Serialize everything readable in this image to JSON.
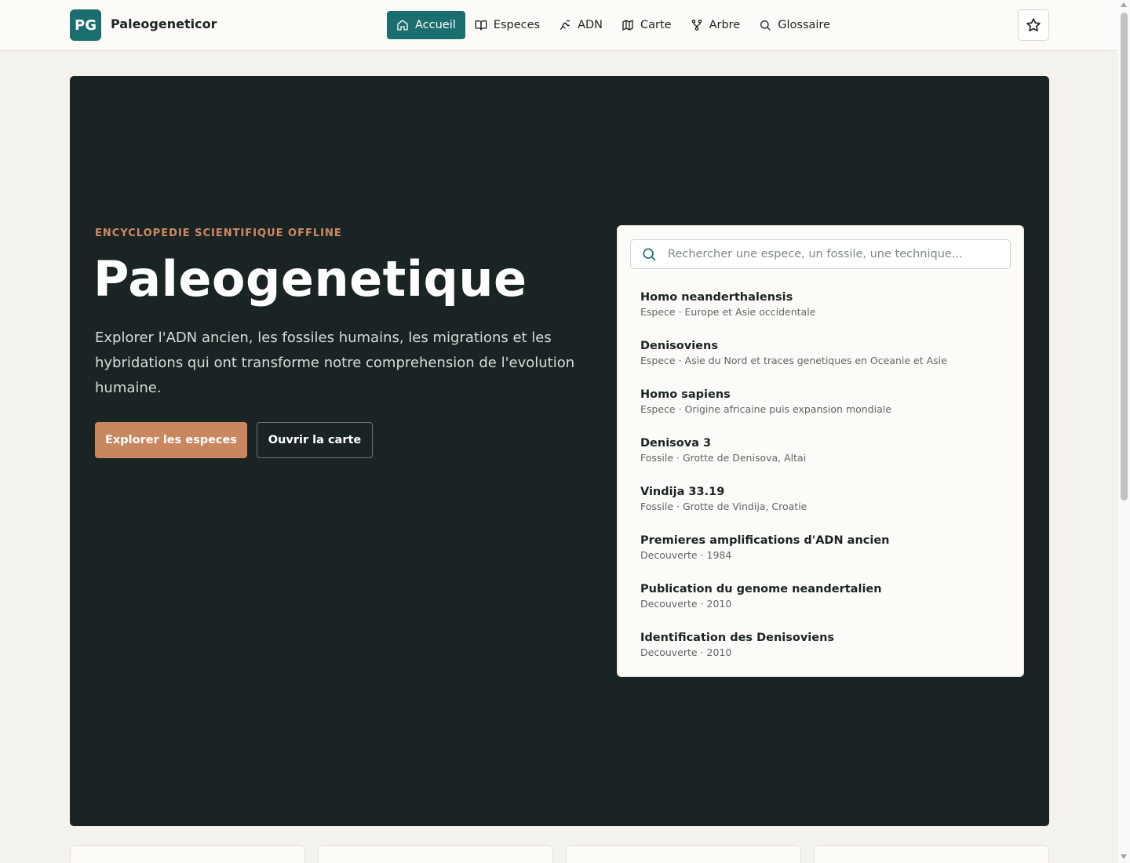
{
  "header": {
    "logo_text": "PG",
    "brand_name": "Paleogeneticor",
    "nav": [
      {
        "label": "Accueil",
        "icon": "home-icon",
        "active": true
      },
      {
        "label": "Especes",
        "icon": "book-icon",
        "active": false
      },
      {
        "label": "ADN",
        "icon": "dna-icon",
        "active": false
      },
      {
        "label": "Carte",
        "icon": "map-icon",
        "active": false
      },
      {
        "label": "Arbre",
        "icon": "tree-icon",
        "active": false
      },
      {
        "label": "Glossaire",
        "icon": "search-icon",
        "active": false
      }
    ],
    "favorites_icon": "star-icon"
  },
  "hero": {
    "eyebrow": "ENCYCLOPEDIE SCIENTIFIQUE OFFLINE",
    "title": "Paleogenetique",
    "description": "Explorer l'ADN ancien, les fossiles humains, les migrations et les hybridations qui ont transforme notre comprehension de l'evolution humaine.",
    "primary_button": "Explorer les especes",
    "secondary_button": "Ouvrir la carte"
  },
  "search": {
    "placeholder": "Rechercher une espece, un fossile, une technique...",
    "results": [
      {
        "title": "Homo neanderthalensis",
        "meta": "Espece · Europe et Asie occidentale"
      },
      {
        "title": "Denisoviens",
        "meta": "Espece · Asie du Nord et traces genetiques en Oceanie et Asie"
      },
      {
        "title": "Homo sapiens",
        "meta": "Espece · Origine africaine puis expansion mondiale"
      },
      {
        "title": "Denisova 3",
        "meta": "Fossile · Grotte de Denisova, Altai"
      },
      {
        "title": "Vindija 33.19",
        "meta": "Fossile · Grotte de Vindija, Croatie"
      },
      {
        "title": "Premieres amplifications d'ADN ancien",
        "meta": "Decouverte · 1984"
      },
      {
        "title": "Publication du genome neandertalien",
        "meta": "Decouverte · 2010"
      },
      {
        "title": "Identification des Denisoviens",
        "meta": "Decouverte · 2010"
      }
    ]
  },
  "colors": {
    "accent": "#1b6e6e",
    "hero_bg": "#1b2424",
    "highlight": "#c98760"
  }
}
